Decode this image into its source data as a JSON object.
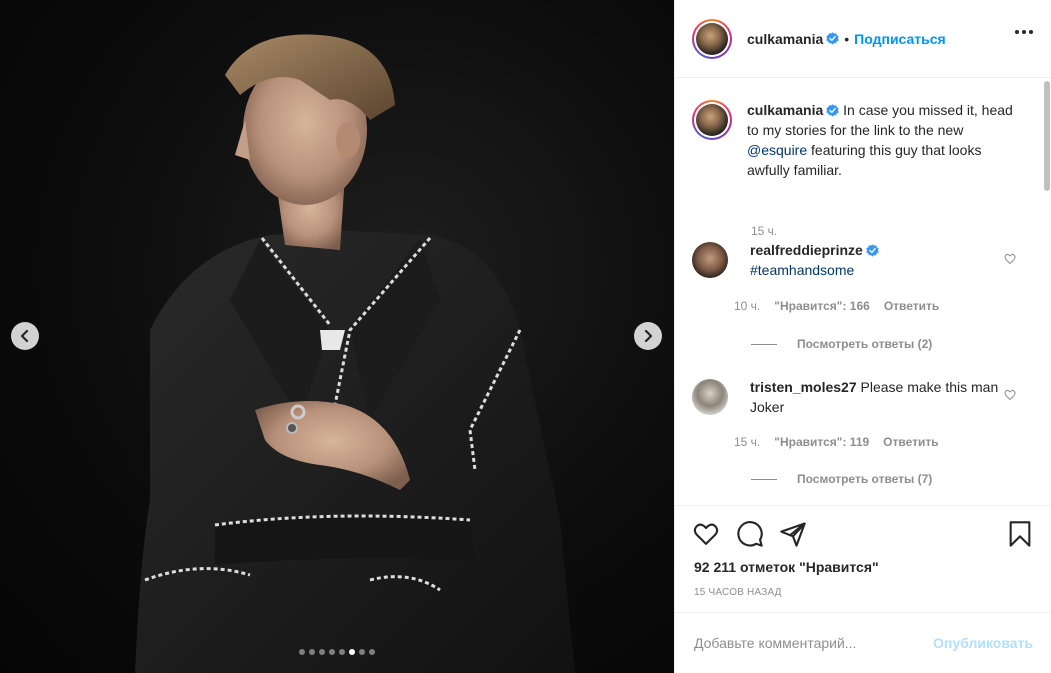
{
  "post": {
    "media": {
      "carousel_dots_total": 8,
      "carousel_active_index": 5
    },
    "header": {
      "username": "culkamania",
      "separator": "•",
      "follow_label": "Подписаться"
    },
    "caption": {
      "username": "culkamania",
      "text_before": "In case you missed it, head to my stories for the link to the new ",
      "mention": "@esquire",
      "text_after": " featuring this guy that looks awfully familiar.",
      "time": "15 ч."
    },
    "comments": [
      {
        "username": "realfreddieprinze",
        "verified": true,
        "text": "#teamhandsome",
        "time": "10 ч.",
        "likes": "\"Нравится\": 166",
        "reply": "Ответить",
        "view_replies": "Посмотреть ответы (2)"
      },
      {
        "username": "tristen_moles27",
        "verified": false,
        "text": "Please make this man Joker",
        "time": "15 ч.",
        "likes": "\"Нравится\": 119",
        "reply": "Ответить",
        "view_replies": "Посмотреть ответы (7)"
      }
    ],
    "actions": {
      "likes_count": "92 211 отметок \"Нравится\"",
      "post_time": "15 ЧАСОВ НАЗАД"
    },
    "add_comment": {
      "placeholder": "Добавьте комментарий...",
      "publish_label": "Опубликовать"
    }
  },
  "colors": {
    "accent": "#0095f6",
    "mention": "#00376b",
    "muted": "#8e8e8e",
    "publish_disabled": "#b2dffc"
  },
  "icons": {
    "verified": "verified-badge-icon",
    "like": "heart-icon",
    "comment": "comment-bubble-icon",
    "share": "paper-plane-icon",
    "save": "bookmark-icon",
    "prev": "chevron-left-icon",
    "next": "chevron-right-icon",
    "more": "more-options-icon"
  }
}
